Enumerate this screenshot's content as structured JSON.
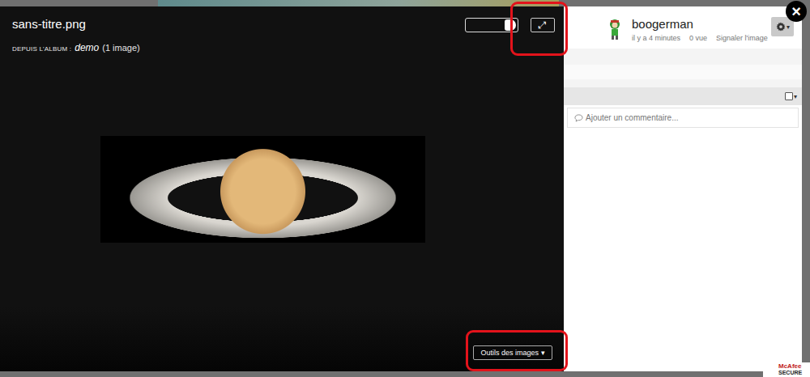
{
  "lightbox": {
    "title": "sans-titre.png",
    "album_label": "DEPUIS L'ALBUM :",
    "album_name": "demo",
    "album_count": "(1 image)",
    "toggle": {
      "on": true
    },
    "expand_button": "⤢",
    "tools_button": "Outils des images",
    "tools_caret": "▾",
    "close_button": "×"
  },
  "sidebar": {
    "author": "boogerman",
    "time": "il y a 4 minutes",
    "views": "0 vue",
    "report": "Signaler l'image",
    "settings_caret": "▾",
    "select_caret": "▾",
    "comment_placeholder": "Ajouter un commentaire..."
  },
  "badge": {
    "brand": "McAfee",
    "label": "SECURE"
  }
}
